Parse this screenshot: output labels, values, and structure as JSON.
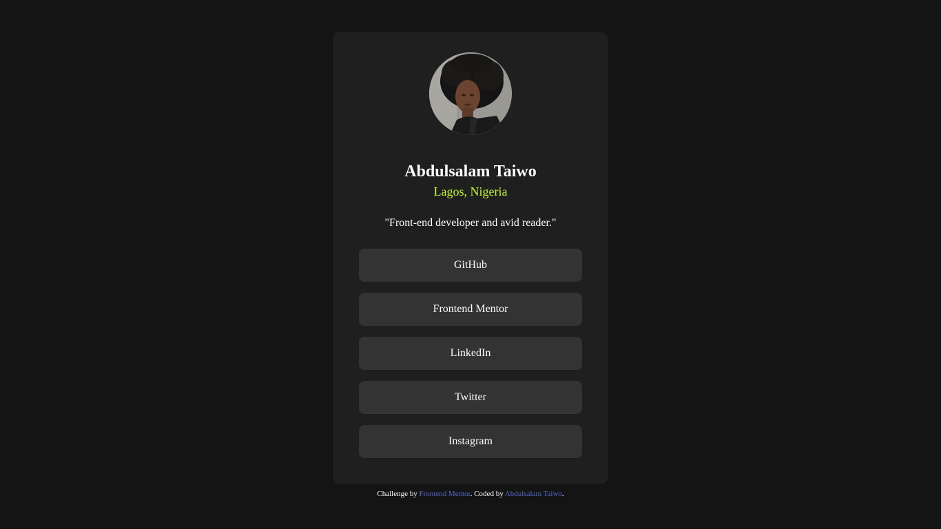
{
  "profile": {
    "name": "Abdulsalam Taiwo",
    "location": "Lagos, Nigeria",
    "bio": "\"Front-end developer and avid reader.\""
  },
  "links": [
    {
      "label": "GitHub"
    },
    {
      "label": "Frontend Mentor"
    },
    {
      "label": "LinkedIn"
    },
    {
      "label": "Twitter"
    },
    {
      "label": "Instagram"
    }
  ],
  "footer": {
    "challenge_prefix": "Challenge by ",
    "challenge_link": "Frontend Mentor",
    "coded_prefix": ". Coded by ",
    "coded_link": "Abdulsalam Taiwo",
    "suffix": "."
  },
  "colors": {
    "background": "#141414",
    "card": "#1f1f1f",
    "button": "#333333",
    "accent_green": "#c4f82a",
    "link_blue": "#5668c9"
  }
}
